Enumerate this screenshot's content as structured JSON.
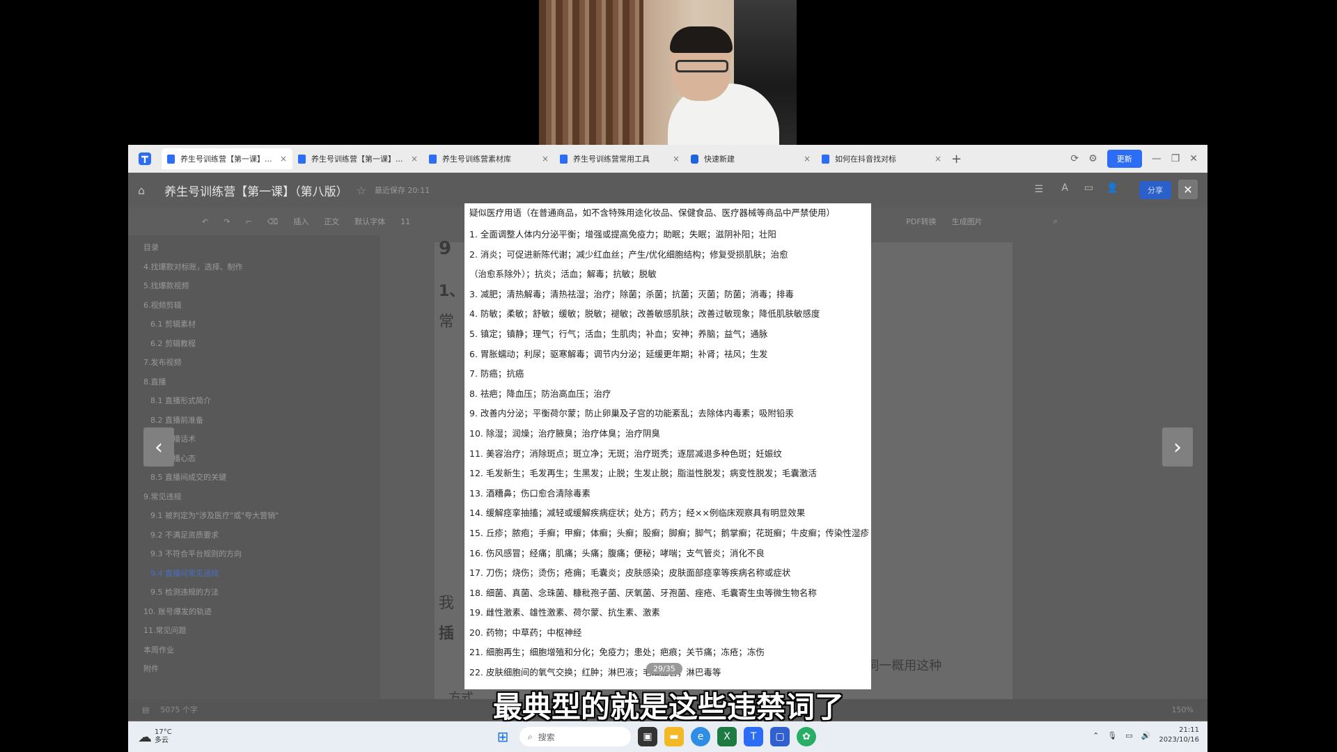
{
  "browser": {
    "tabs": [
      {
        "label": "养生号训练营【第一课】...",
        "active": true
      },
      {
        "label": "养生号训练营【第一课】...",
        "active": false
      },
      {
        "label": "养生号训练营素材库",
        "active": false
      },
      {
        "label": "养生号训练营常用工具",
        "active": false
      },
      {
        "label": "快速新建",
        "active": false
      },
      {
        "label": "如何在抖音找对标",
        "active": false
      }
    ],
    "update_label": "更新"
  },
  "document": {
    "title": "养生号训练营【第一课】（第八版）",
    "meta": "最近保存 20:11",
    "share_label": "分享"
  },
  "toolbar": {
    "insert": "插入",
    "style": "正文",
    "font": "默认字体",
    "size": "11",
    "pdf": "PDF转换",
    "gen_image": "生成图片"
  },
  "sidebar": {
    "header": "目录",
    "items": [
      {
        "label": "4.找爆款对标账，选择、制作",
        "sub": false,
        "hl": false
      },
      {
        "label": "5.找爆款视频",
        "sub": false,
        "hl": false
      },
      {
        "label": "6.视频剪辑",
        "sub": false,
        "hl": false
      },
      {
        "label": "6.1 剪辑素材",
        "sub": true,
        "hl": false
      },
      {
        "label": "6.2 剪辑教程",
        "sub": true,
        "hl": false
      },
      {
        "label": "7.发布视频",
        "sub": false,
        "hl": false
      },
      {
        "label": "8.直播",
        "sub": false,
        "hl": false
      },
      {
        "label": "8.1 直播形式简介",
        "sub": true,
        "hl": false
      },
      {
        "label": "8.2 直播前准备",
        "sub": true,
        "hl": false
      },
      {
        "label": "8.3 直播话术",
        "sub": true,
        "hl": false
      },
      {
        "label": "8.4 直播心态",
        "sub": true,
        "hl": false
      },
      {
        "label": "8.5 直播间成交的关键",
        "sub": true,
        "hl": false
      },
      {
        "label": "9.常见违规",
        "sub": false,
        "hl": false
      },
      {
        "label": "9.1 被判定为\"涉及医疗\"或\"夸大营销\"",
        "sub": true,
        "hl": false
      },
      {
        "label": "9.2 不满足资质要求",
        "sub": true,
        "hl": false
      },
      {
        "label": "9.3 不符合平台规则的方向",
        "sub": true,
        "hl": false
      },
      {
        "label": "9.4 直播间常见违规",
        "sub": true,
        "hl": true
      },
      {
        "label": "9.5 检测违规的方法",
        "sub": true,
        "hl": false
      },
      {
        "label": "10. 账号爆发的轨迹",
        "sub": false,
        "hl": false
      },
      {
        "label": "11.常见问题",
        "sub": false,
        "hl": false
      },
      {
        "label": "本周作业",
        "sub": false,
        "hl": false
      },
      {
        "label": "附件",
        "sub": false,
        "hl": false
      }
    ]
  },
  "page_fragments": {
    "f1": "9",
    "f2": "1、",
    "f3": "常",
    "f4": "我",
    "f5": "插",
    "f6": "火\"，把握不准的词一概用这种",
    "f7": "方式"
  },
  "status": {
    "words": "5075 个字",
    "zoom": "150%"
  },
  "popup": {
    "heading": "疑似医疗用语（在普通商品，如不含特殊用途化妆品、保健食品、医疗器械等商品中严禁使用）",
    "lines": [
      "1. 全面调整人体内分泌平衡；增强或提高免疫力；助眠；失眠；滋阴补阳；壮阳",
      "2. 消炎；可促进新陈代谢；减少红血丝；产生/优化细胞结构；修复受损肌肤；治愈",
      "（治愈系除外）；抗炎；活血；解毒；抗敏；脱敏",
      "3. 减肥；清热解毒；清热祛湿；治疗；除菌；杀菌；抗菌；灭菌；防菌；消毒；排毒",
      "4. 防敏；柔敏；舒敏；缓敏；脱敏；褪敏；改善敏感肌肤；改善过敏现象；降低肌肤敏感度",
      "5. 镇定；镇静；理气；行气；活血；生肌肉；补血；安神；养脑；益气；通脉",
      "6. 胃胀蠕动；利尿；驱寒解毒；调节内分泌；延缓更年期；补肾；祛风；生发",
      "7. 防癌；抗癌",
      "8. 祛疤；降血压；防治高血压；治疗",
      "9. 改善内分泌；平衡荷尔蒙；防止卵巢及子宫的功能紊乱；去除体内毒素；吸附铅汞",
      "10. 除湿；润燥；治疗腋臭；治疗体臭；治疗阴臭",
      "11. 美容治疗；消除斑点；斑立净；无斑；治疗斑秃；逐层减退多种色斑；妊娠纹",
      "12. 毛发新生；毛发再生；生黑发；止脱；生发止脱；脂溢性脱发；病变性脱发；毛囊激活",
      "13. 酒糟鼻；伤口愈合清除毒素",
      "14. 缓解痉挛抽搐；减轻或缓解疾病症状；处方；药方；经××例临床观察具有明显效果",
      "15. 丘疹；脓疱；手癣；甲癣；体癣；头癣；股癣；脚癣；脚气；鹅掌癣；花斑癣；牛皮癣；传染性湿疹",
      "16. 伤风感冒；经痛；肌痛；头痛；腹痛；便秘；哮喘；支气管炎；消化不良",
      "17. 刀伤；烧伤；烫伤；疮痈；毛囊炎；皮肤感染；皮肤面部痉挛等疾病名称或症状",
      "18. 细菌、真菌、念珠菌、糠秕孢子菌、厌氧菌、牙孢菌、痤疮、毛囊寄生虫等微生物名称",
      "19. 雌性激素、雄性激素、荷尔蒙、抗生素、激素",
      "20. 药物；中草药；中枢神经",
      "21. 细胞再生；细胞增殖和分化；免疫力；患处；疤痕；关节痛；冻疮；冻伤",
      "22. 皮肤细胞间的氧气交换；红肿；淋巴液；毛细血管；淋巴毒等"
    ],
    "page_indicator": "29/35"
  },
  "taskbar": {
    "temp": "17°C",
    "weather": "多云",
    "search": "搜索",
    "time": "21:11",
    "date": "2023/10/16"
  },
  "subtitle": "最典型的就是这些违禁词了",
  "colors": {
    "accent": "#2b6ef5",
    "overlay": "#5e5e5e"
  }
}
